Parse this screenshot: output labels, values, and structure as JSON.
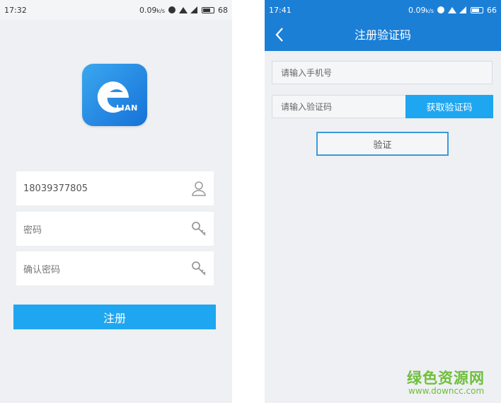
{
  "left_screen": {
    "status_bar": {
      "time": "17:32",
      "speed": "0.09",
      "speed_unit": "k/s",
      "battery": "68"
    },
    "logo": {
      "text": "LIAN",
      "icon": "eliam-logo-icon"
    },
    "fields": {
      "phone": {
        "value": "18039377805",
        "icon": "user-icon"
      },
      "password": {
        "placeholder": "密码",
        "icon": "key-icon"
      },
      "confirm_password": {
        "placeholder": "确认密码",
        "icon": "key-icon"
      }
    },
    "register_button": "注册"
  },
  "right_screen": {
    "status_bar": {
      "time": "17:41",
      "speed": "0.09",
      "speed_unit": "k/s",
      "battery": "66"
    },
    "header": {
      "title": "注册验证码",
      "back_icon": "chevron-left-icon"
    },
    "phone_input": {
      "placeholder": "请输入手机号"
    },
    "code_input": {
      "placeholder": "请输入验证码"
    },
    "get_code_button": "获取验证码",
    "verify_button": "验证"
  },
  "watermark": {
    "text": "绿色资源网",
    "url": "www.downcc.com"
  },
  "colors": {
    "accent": "#1fa6f0",
    "header": "#1c7fd6",
    "watermark": "#6fbf3a"
  }
}
